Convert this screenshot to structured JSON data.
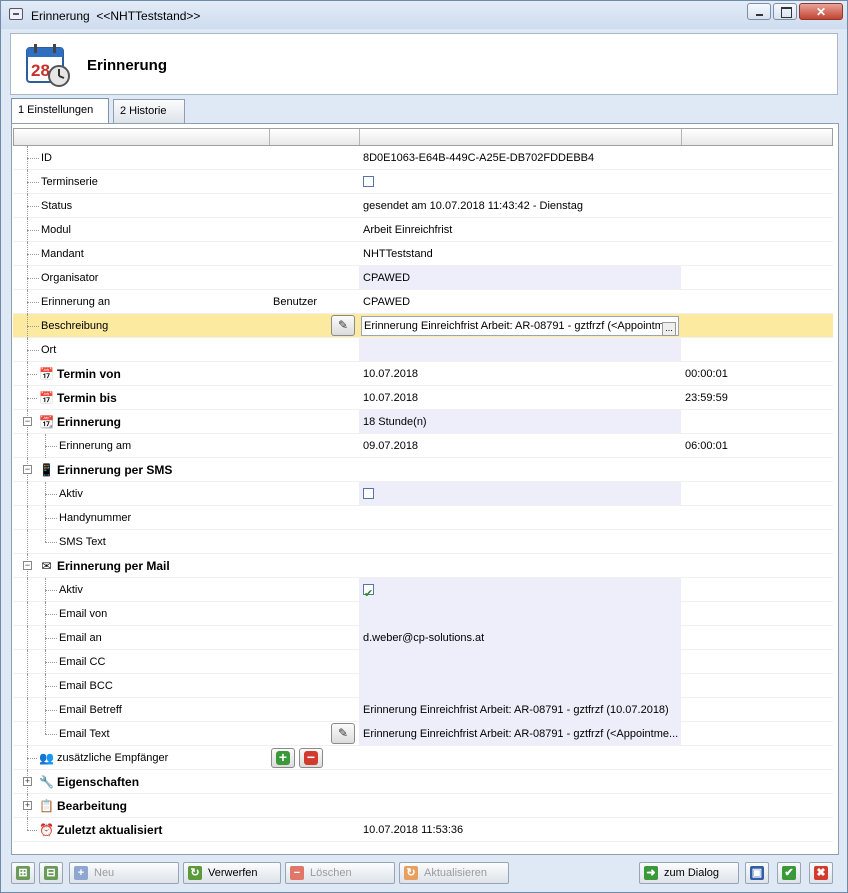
{
  "window": {
    "title": "Erinnerung  <<NHTTeststand>>",
    "header_title": "Erinnerung",
    "calendar_day": "28"
  },
  "tabs": [
    {
      "label": "1 Einstellungen",
      "active": true
    },
    {
      "label": "2 Historie",
      "active": false
    }
  ],
  "rows": {
    "id": {
      "label": "ID",
      "value": "8D0E1063-E64B-449C-A25E-DB702FDDEBB4"
    },
    "terminserie": {
      "label": "Terminserie",
      "checked": false
    },
    "status": {
      "label": "Status",
      "value": "gesendet am 10.07.2018 11:43:42 - Dienstag"
    },
    "modul": {
      "label": "Modul",
      "value": "Arbeit Einreichfrist"
    },
    "mandant": {
      "label": "Mandant",
      "value": "NHTTeststand"
    },
    "organisator": {
      "label": "Organisator",
      "value": "CPAWED"
    },
    "erinnerung_an": {
      "label": "Erinnerung an",
      "type": "Benutzer",
      "value": "CPAWED"
    },
    "beschreibung": {
      "label": "Beschreibung",
      "value": "Erinnerung Einreichfrist Arbeit: AR-08791 - gztfrzf (<Appointm",
      "ellipsis": "..."
    },
    "ort": {
      "label": "Ort",
      "value": ""
    },
    "termin_von": {
      "label": "Termin von",
      "date": "10.07.2018",
      "time": "00:00:01"
    },
    "termin_bis": {
      "label": "Termin bis",
      "date": "10.07.2018",
      "time": "23:59:59"
    },
    "erinnerung": {
      "label": "Erinnerung",
      "value": "18 Stunde(n)"
    },
    "erinnerung_am": {
      "label": "Erinnerung am",
      "date": "09.07.2018",
      "time": "06:00:01"
    },
    "sms": {
      "label": "Erinnerung per SMS"
    },
    "sms_aktiv": {
      "label": "Aktiv",
      "checked": false
    },
    "handynummer": {
      "label": "Handynummer",
      "value": ""
    },
    "sms_text": {
      "label": "SMS Text",
      "value": ""
    },
    "mail": {
      "label": "Erinnerung per Mail"
    },
    "mail_aktiv": {
      "label": "Aktiv",
      "checked": true
    },
    "email_von": {
      "label": "Email von",
      "value": ""
    },
    "email_an": {
      "label": "Email an",
      "value": "d.weber@cp-solutions.at"
    },
    "email_cc": {
      "label": "Email CC",
      "value": ""
    },
    "email_bcc": {
      "label": "Email BCC",
      "value": ""
    },
    "email_betreff": {
      "label": "Email Betreff",
      "value": "Erinnerung Einreichfrist Arbeit: AR-08791 - gztfrzf (10.07.2018)"
    },
    "email_text": {
      "label": "Email Text",
      "value": "Erinnerung Einreichfrist Arbeit: AR-08791 - gztfrzf (<Appointme..."
    },
    "empfaenger": {
      "label": "zusätzliche Empfänger"
    },
    "eigenschaften": {
      "label": "Eigenschaften"
    },
    "bearbeitung": {
      "label": "Bearbeitung"
    },
    "zuletzt": {
      "label": "Zuletzt aktualisiert",
      "value": "10.07.2018 11:53:36"
    }
  },
  "toolbar": {
    "neu": "Neu",
    "verwerfen": "Verwerfen",
    "loeschen": "Löschen",
    "aktualisieren": "Aktualisieren",
    "zum_dialog": "zum Dialog"
  },
  "colors": {
    "highlight_row": "#fbeaa0",
    "value_shade": "#eeeefa",
    "window_bg": "#dfe9f5"
  }
}
